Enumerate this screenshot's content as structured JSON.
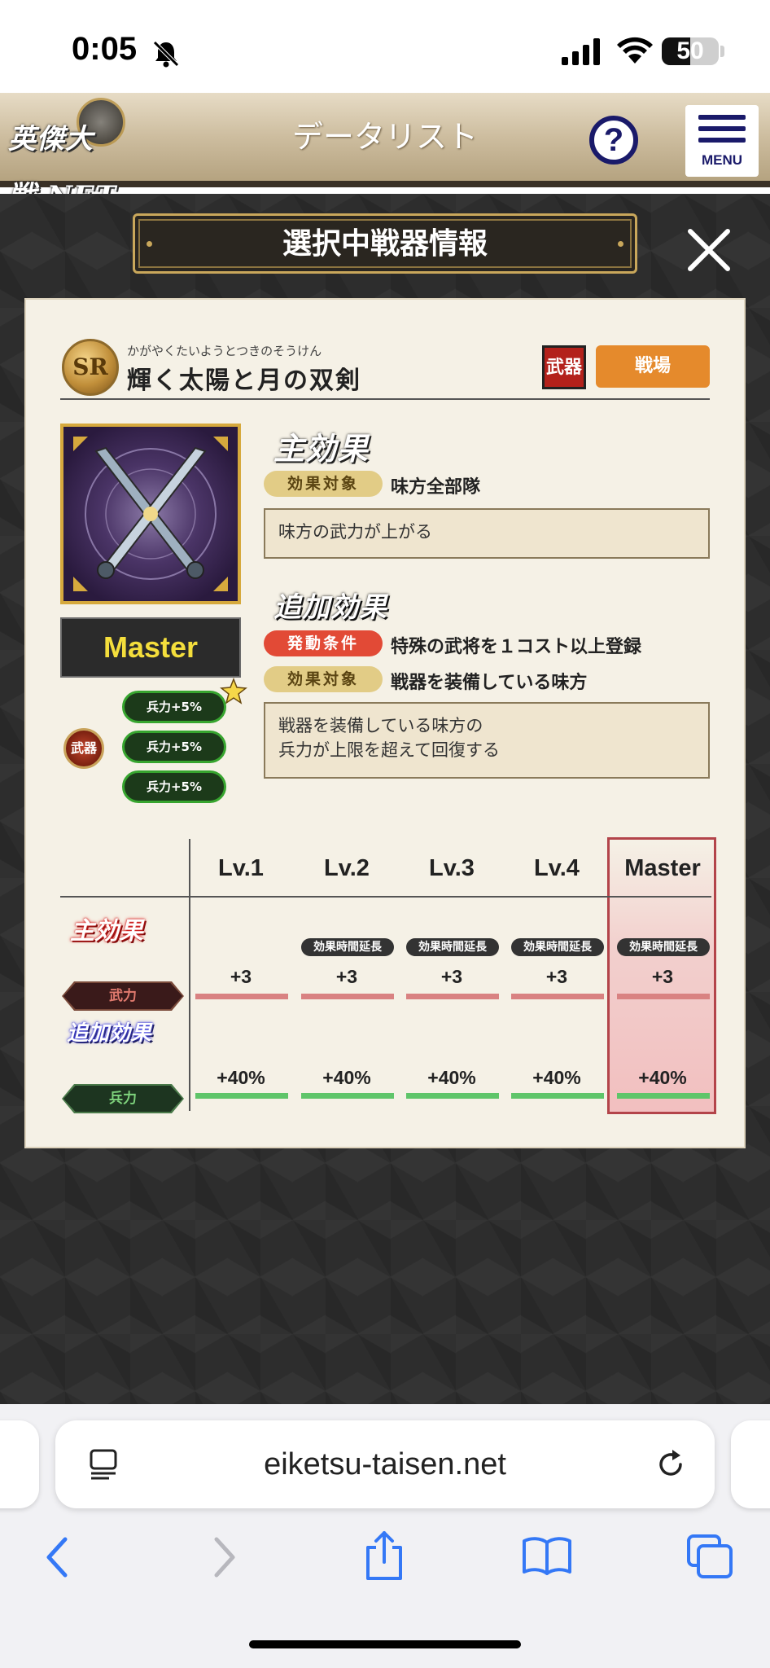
{
  "status": {
    "time": "0:05",
    "battery": "50",
    "battery_level": 0.5
  },
  "header": {
    "logo_text": "英傑大戦.NET",
    "title": "データリスト",
    "help_label": "?",
    "menu_label": "MENU"
  },
  "modal": {
    "title": "選択中戦器情報"
  },
  "weapon": {
    "rarity": "SR",
    "reading": "かがやくたいようとつきのそうけん",
    "name": "輝く太陽と月の双剣",
    "type_icon": "武器",
    "battle_button": "戦場",
    "master_label": "Master",
    "bonus_icon_label": "武器",
    "bonuses": [
      "兵力+5%",
      "兵力+5%",
      "兵力+5%"
    ]
  },
  "main_effect": {
    "title": "主効果",
    "target_tag": "効果対象",
    "target_value": "味方全部隊",
    "description": "味方の武力が上がる"
  },
  "extra_effect": {
    "title": "追加効果",
    "condition_tag": "発動条件",
    "condition_value": "特殊の武将を１コスト以上登録",
    "target_tag": "効果対象",
    "target_value": "戦器を装備している味方",
    "description_line1": "戦器を装備している味方の",
    "description_line2": "兵力が上限を超えて回復する"
  },
  "level_table": {
    "headers": [
      "Lv.1",
      "Lv.2",
      "Lv.3",
      "Lv.4",
      "Master"
    ],
    "row_main_label": "主効果",
    "row_extra_label": "追加効果",
    "main_stat": "武力",
    "extra_stat": "兵力",
    "extension_badge": "効果時間延長",
    "main_values": [
      "+3",
      "+3",
      "+3",
      "+3",
      "+3"
    ],
    "extra_values": [
      "+40%",
      "+40%",
      "+40%",
      "+40%",
      "+40%"
    ]
  },
  "browser": {
    "url": "eiketsu-taisen.net"
  },
  "icons": [
    "bell-slash-icon",
    "signal-icon",
    "wifi-icon",
    "battery-icon",
    "help-icon",
    "menu-icon",
    "close-icon",
    "star-icon",
    "reader-icon",
    "reload-icon",
    "back-icon",
    "forward-icon",
    "share-icon",
    "bookmarks-icon",
    "tabs-icon"
  ]
}
